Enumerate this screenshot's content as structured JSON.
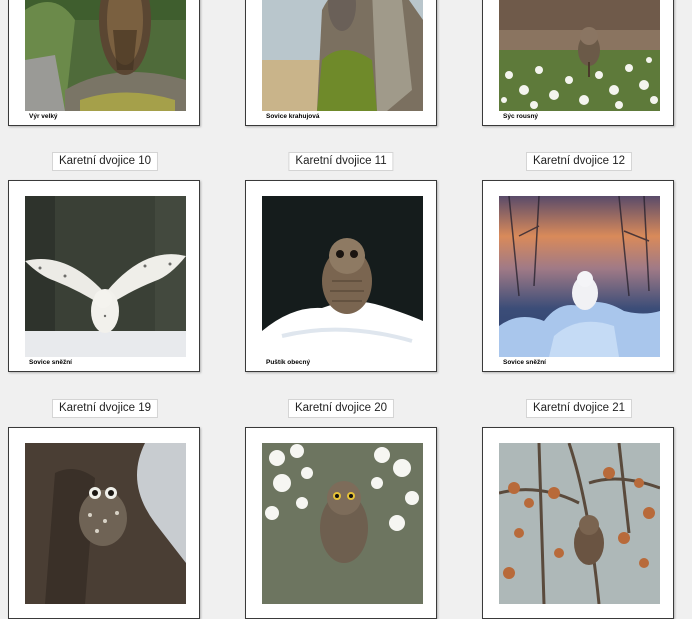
{
  "row1": {
    "cards": [
      {
        "caption": "Výr velký",
        "photo": "eagle-owl-on-rock"
      },
      {
        "caption": "Sovice krahujová",
        "photo": "hawk-owl-on-mossy-stump"
      },
      {
        "caption": "Sýc rousný",
        "photo": "boreal-owl-in-flowers"
      }
    ]
  },
  "row2": {
    "labels": [
      "Karetní dvojice 10",
      "Karetní dvojice 11",
      "Karetní dvojice 12"
    ],
    "cards": [
      {
        "caption": "Sovice sněžní",
        "photo": "snowy-owl-wings-spread"
      },
      {
        "caption": "Puštík obecný",
        "photo": "tawny-owl-on-snow"
      },
      {
        "caption": "Sovice sněžní",
        "photo": "snowy-owl-sunset-snow"
      }
    ]
  },
  "row3": {
    "labels": [
      "Karetní dvojice 19",
      "Karetní dvojice 20",
      "Karetní dvojice 21"
    ],
    "cards": [
      {
        "caption": "",
        "photo": "little-owl-in-tree-hollow"
      },
      {
        "caption": "",
        "photo": "little-owl-among-blossoms"
      },
      {
        "caption": "",
        "photo": "owl-in-autumn-leaves"
      }
    ]
  }
}
